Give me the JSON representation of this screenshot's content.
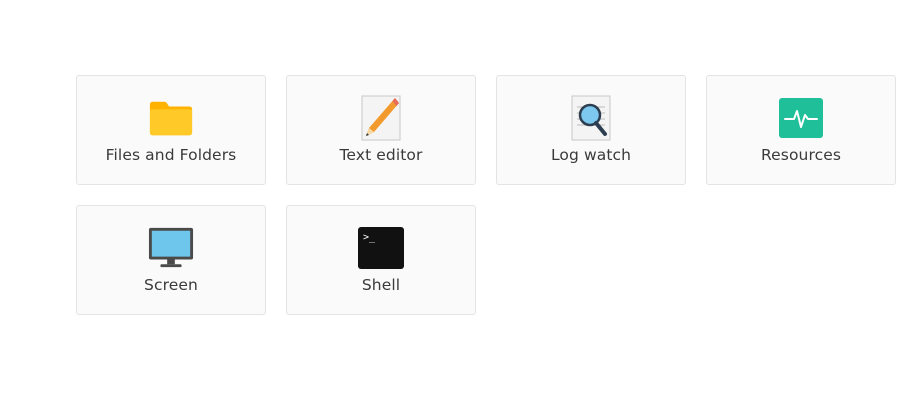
{
  "apps": [
    {
      "label": "Files and Folders",
      "icon": "folder-icon"
    },
    {
      "label": "Text editor",
      "icon": "pencil-icon"
    },
    {
      "label": "Log watch",
      "icon": "magnifier-icon"
    },
    {
      "label": "Resources",
      "icon": "pulse-monitor-icon"
    },
    {
      "label": "Screen",
      "icon": "monitor-icon"
    },
    {
      "label": "Shell",
      "icon": "terminal-icon"
    }
  ],
  "colors": {
    "folder": "#ffca28",
    "folder_tab": "#ffb300",
    "resources": "#1fbf99",
    "screen": "#6ec6ec",
    "screen_frame": "#4a4a4a",
    "terminal": "#111111"
  },
  "shell_prompt": ">_"
}
